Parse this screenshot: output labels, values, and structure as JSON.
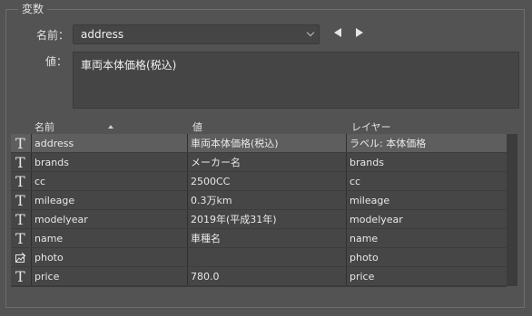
{
  "group_title": "変数",
  "name_label": "名前：",
  "name_value": "address",
  "value_label": "値：",
  "value_text": "車両本体価格(税込)",
  "table": {
    "headers": {
      "name": "名前",
      "value": "値",
      "layer": "レイヤー"
    },
    "rows": [
      {
        "icon": "text-icon",
        "name": "address",
        "value": "車両本体価格(税込)",
        "layer": "ラベル: 本体価格",
        "selected": true
      },
      {
        "icon": "text-icon",
        "name": "brands",
        "value": "メーカー名",
        "layer": "brands"
      },
      {
        "icon": "text-icon",
        "name": "cc",
        "value": "2500CC",
        "layer": "cc"
      },
      {
        "icon": "text-icon",
        "name": "mileage",
        "value": "0.3万km",
        "layer": "mileage"
      },
      {
        "icon": "text-icon",
        "name": "modelyear",
        "value": "2019年(平成31年)",
        "layer": "modelyear"
      },
      {
        "icon": "text-icon",
        "name": "name",
        "value": "車種名",
        "layer": "name"
      },
      {
        "icon": "image-icon",
        "name": "photo",
        "value": "",
        "layer": "photo"
      },
      {
        "icon": "text-icon",
        "name": "price",
        "value": "780.0",
        "layer": "price"
      }
    ]
  },
  "colors": {
    "panel_bg": "#535353",
    "row_bg": "#464646",
    "selected_row_bg": "#5e5e5e"
  }
}
